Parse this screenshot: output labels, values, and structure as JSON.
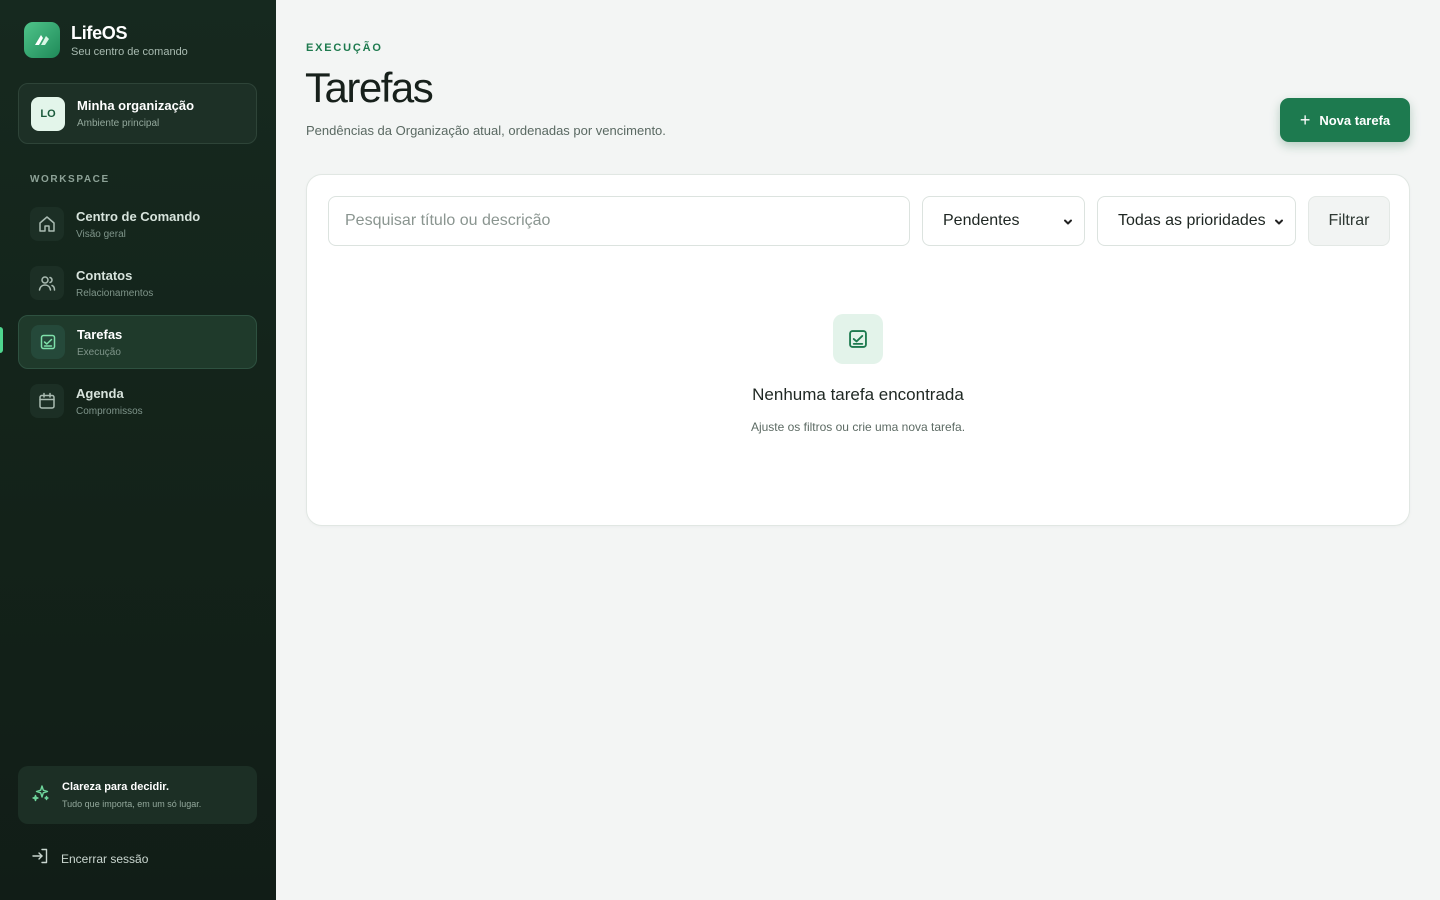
{
  "brand": {
    "name": "LifeOS",
    "tagline": "Seu centro de comando"
  },
  "org": {
    "initials": "LO",
    "name": "Minha organização",
    "sub": "Ambiente principal"
  },
  "sidebar": {
    "section_label": "WORKSPACE",
    "items": [
      {
        "label": "Centro de Comando",
        "sub": "Visão geral",
        "icon": "home-icon",
        "active": false
      },
      {
        "label": "Contatos",
        "sub": "Relacionamentos",
        "icon": "users-icon",
        "active": false
      },
      {
        "label": "Tarefas",
        "sub": "Execução",
        "icon": "task-check-icon",
        "active": true
      },
      {
        "label": "Agenda",
        "sub": "Compromissos",
        "icon": "calendar-icon",
        "active": false
      }
    ],
    "tip": {
      "title": "Clareza para decidir.",
      "sub": "Tudo que importa, em um só lugar."
    },
    "logout_label": "Encerrar sessão"
  },
  "header": {
    "eyebrow": "EXECUÇÃO",
    "title": "Tarefas",
    "description": "Pendências da Organização atual, ordenadas por vencimento.",
    "new_button_label": "Nova tarefa"
  },
  "filters": {
    "search_placeholder": "Pesquisar título ou descrição",
    "status_selected": "Pendentes",
    "priority_selected": "Todas as prioridades",
    "filter_button_label": "Filtrar"
  },
  "empty_state": {
    "title": "Nenhuma tarefa encontrada",
    "sub": "Ajuste os filtros ou crie uma nova tarefa."
  },
  "colors": {
    "sidebar_bg": "#14261c",
    "accent": "#1d7a4f",
    "accent_light": "#4fd68f"
  }
}
